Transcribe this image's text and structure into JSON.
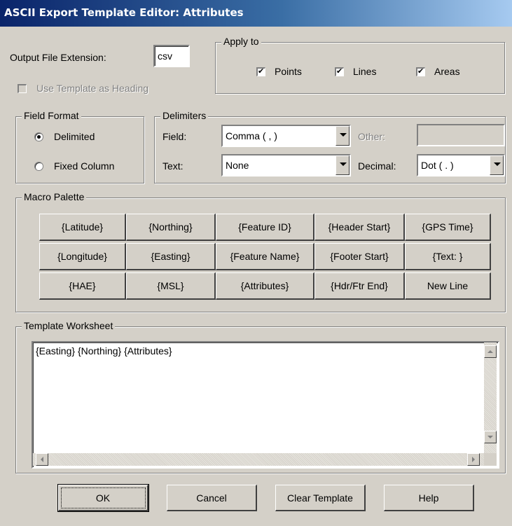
{
  "window": {
    "title": "ASCII Export Template Editor: Attributes"
  },
  "output": {
    "label": "Output File Extension:",
    "value": "csv"
  },
  "use_template_heading": {
    "label": "Use Template as Heading",
    "checked": false
  },
  "apply_to": {
    "legend": "Apply to",
    "points": {
      "label": "Points",
      "checked": true
    },
    "lines": {
      "label": "Lines",
      "checked": true
    },
    "areas": {
      "label": "Areas",
      "checked": true
    }
  },
  "field_format": {
    "legend": "Field Format",
    "delimited": {
      "label": "Delimited",
      "selected": true
    },
    "fixed_column": {
      "label": "Fixed Column",
      "selected": false
    }
  },
  "delimiters": {
    "legend": "Delimiters",
    "field_label": "Field:",
    "field_value": "Comma ( , )",
    "other_label": "Other:",
    "other_value": "",
    "text_label": "Text:",
    "text_value": "None",
    "decimal_label": "Decimal:",
    "decimal_value": "Dot ( . )"
  },
  "macro_palette": {
    "legend": "Macro Palette",
    "buttons": [
      "{Latitude}",
      "{Northing}",
      "{Feature ID}",
      "{Header Start}",
      "{GPS Time}",
      "{Longitude}",
      "{Easting}",
      "{Feature Name}",
      "{Footer Start}",
      "{Text: }",
      "{HAE}",
      "{MSL}",
      "{Attributes}",
      "{Hdr/Ftr End}",
      "New Line"
    ]
  },
  "worksheet": {
    "legend": "Template Worksheet",
    "content": "{Easting} {Northing} {Attributes}"
  },
  "footer": {
    "ok": "OK",
    "cancel": "Cancel",
    "clear": "Clear Template",
    "help": "Help"
  },
  "icons": [
    "check-icon",
    "radio-icon",
    "dropdown-arrow-icon",
    "scroll-up-icon",
    "scroll-down-icon",
    "scroll-left-icon",
    "scroll-right-icon"
  ]
}
